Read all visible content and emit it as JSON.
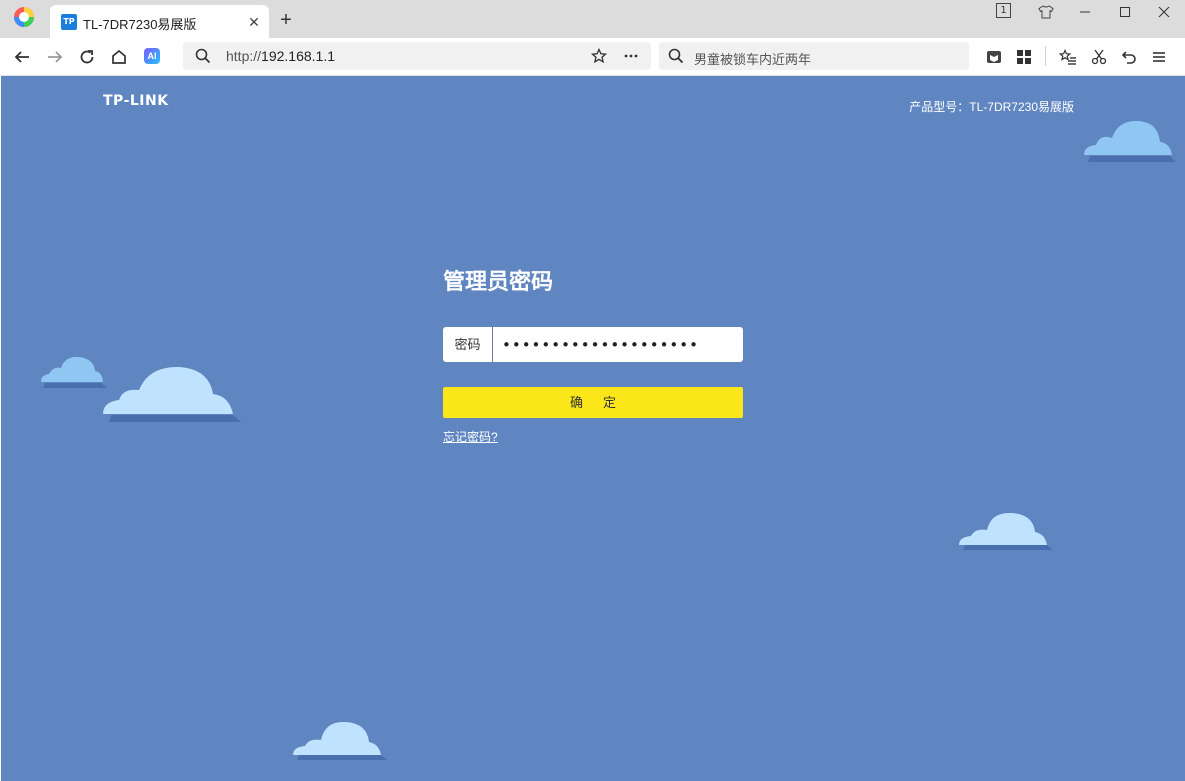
{
  "browser": {
    "tab": {
      "favicon": "TP",
      "title": "TL-7DR7230易展版"
    },
    "window_count": "1",
    "address": {
      "scheme": "http://",
      "host": "192.168.1.1"
    },
    "ai_label": "AI",
    "search": {
      "placeholder": "男童被锁车内近两年"
    }
  },
  "page": {
    "logo": "TP-LINK",
    "model": "产品型号：TL-7DR7230易展版",
    "login": {
      "title": "管理员密码",
      "password_label": "密码",
      "password_value": "••••••••••••••••••••",
      "confirm_label": "确定",
      "forgot_link": "忘记密码?"
    }
  },
  "colors": {
    "page_bg": "#5f86c0",
    "button": "#fbe619",
    "cloud_light": "#bfe3ff",
    "cloud_shadow": "#4a6fae"
  }
}
